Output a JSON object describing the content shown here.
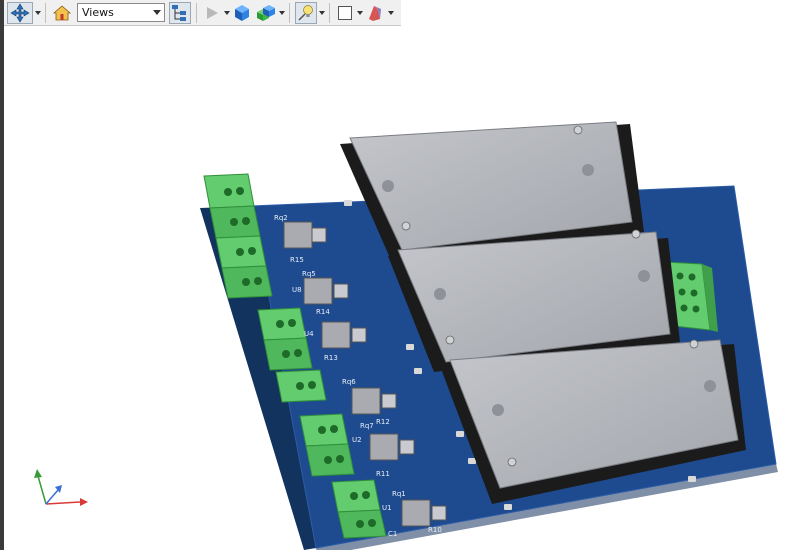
{
  "toolbar": {
    "navigate_icon": "navigate-pan-icon",
    "home_icon": "home-icon",
    "views_select": {
      "value": "Views"
    },
    "model_tree_icon": "model-tree-icon",
    "play_icon": "play-icon",
    "box_icon": "solid-box-icon",
    "shading_icon": "shading-icon",
    "lighting_icon": "lighting-icon",
    "background_icon": "background-color-icon",
    "section_icon": "section-icon"
  },
  "board": {
    "connector_color": "#5cc96a",
    "pcb_color": "#1e4b8f",
    "module_color": "#aeb1b7",
    "silkscreen_labels": {
      "q2": "Rq2",
      "q5": "Rq5",
      "r15": "R15",
      "r14": "R14",
      "u8": "U8",
      "r13": "R13",
      "u4": "U4",
      "q6": "Rq6",
      "r12": "R12",
      "u2": "U2",
      "q7": "Rq7",
      "r11": "R11",
      "q1": "Rq1",
      "u1": "U1",
      "c1": "C1",
      "r10": "R10"
    }
  }
}
